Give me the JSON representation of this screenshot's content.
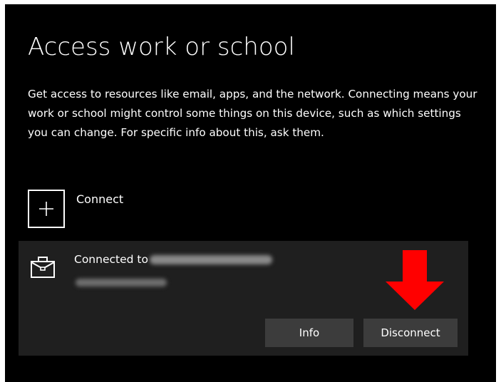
{
  "page": {
    "title": "Access work or school",
    "description": "Get access to resources like email, apps, and the network. Connecting means your work or school might control some things on this device, such as which settings you can change. For specific info about this, ask them."
  },
  "connect": {
    "label": "Connect",
    "icon": "plus-icon"
  },
  "account": {
    "icon": "briefcase-icon",
    "connected_prefix": "Connected to",
    "buttons": {
      "info_label": "Info",
      "disconnect_label": "Disconnect"
    }
  },
  "annotation": {
    "icon": "arrow-down-icon",
    "color": "#ff0000"
  },
  "colors": {
    "background": "#000000",
    "panel": "#1f1f1f",
    "button": "#3c3c3c",
    "text": "#ffffff"
  }
}
